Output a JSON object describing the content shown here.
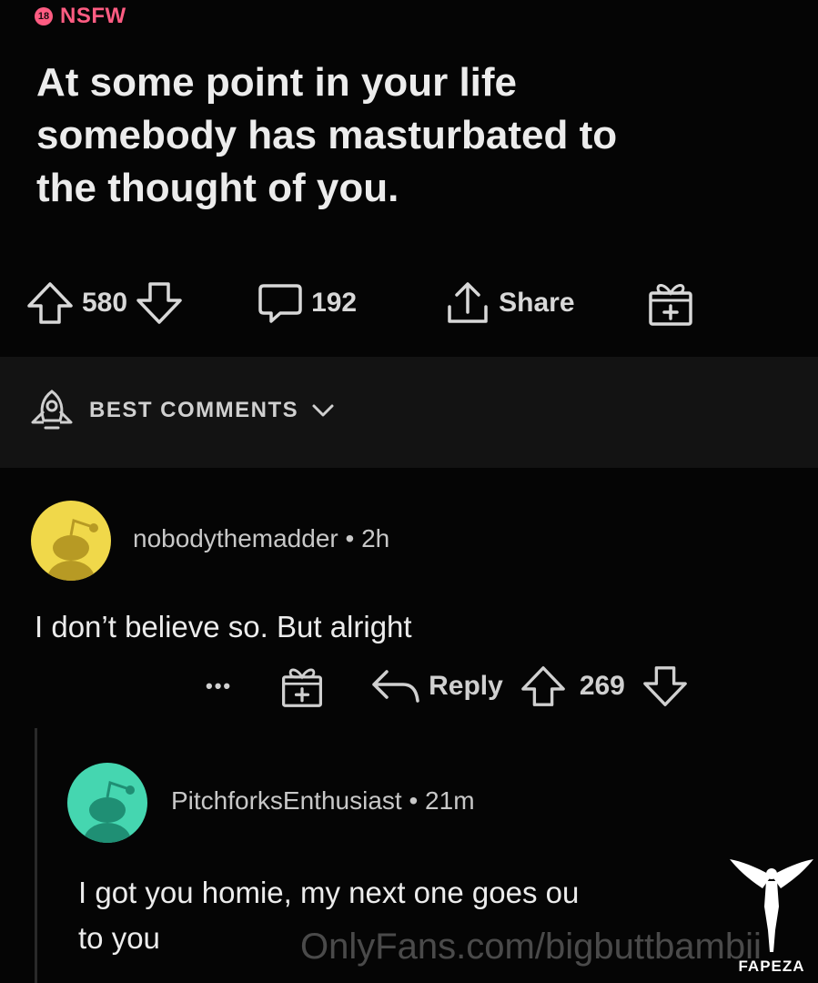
{
  "post": {
    "badge_number": "18",
    "badge_label": "NSFW",
    "title_lines": [
      "At some point in your life",
      "somebody has masturbated to",
      "the thought of you."
    ],
    "upvotes": "580",
    "comments": "192",
    "share_label": "Share"
  },
  "sort": {
    "label": "BEST COMMENTS"
  },
  "comments": [
    {
      "username": "nobodythemadder",
      "time": "2h",
      "body": "I don’t believe so. But alright",
      "more": "•••",
      "reply_label": "Reply",
      "score": "269",
      "avatar_color": "#f0d84a"
    },
    {
      "username": "PitchforksEnthusiast",
      "time": "21m",
      "body_lines": [
        "I got you homie, my next one goes ou",
        "to you"
      ],
      "avatar_color": "#45d6b0"
    }
  ],
  "watermark": {
    "text": "OnlyFans.com/bigbuttbambii",
    "brand": "FAPEZA"
  },
  "colors": {
    "nsfw": "#ff5c82",
    "background": "#050505",
    "sort_bar": "#131313"
  }
}
